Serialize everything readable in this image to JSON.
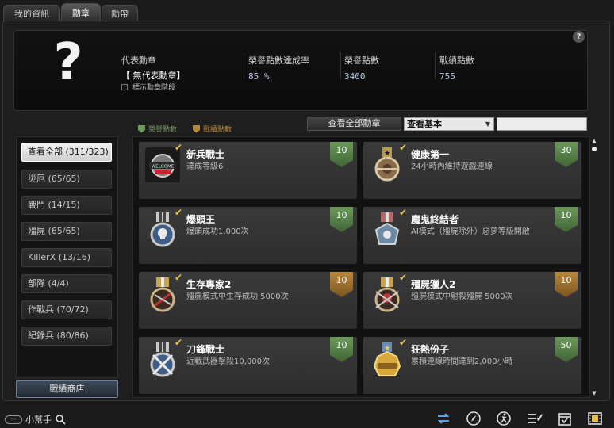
{
  "tabs": [
    {
      "label": "我的資訊"
    },
    {
      "label": "勳章"
    },
    {
      "label": "勳帶"
    }
  ],
  "header": {
    "placeholder_symbol": "?",
    "help_symbol": "?",
    "representative": {
      "label": "代表勳章",
      "value": "【 無代表勳章】"
    },
    "honor_rate": {
      "label": "榮譽點數達成率",
      "value": "85 %"
    },
    "honor_points": {
      "label": "榮譽點數",
      "value": "3400"
    },
    "battle_points": {
      "label": "戰績點數",
      "value": "755"
    },
    "show_stage_label": "標示勳章階段"
  },
  "legend": {
    "honor": "榮譽點數",
    "battle": "戰績點數",
    "honor_color": "#7c9a6c",
    "battle_color": "#b8893c"
  },
  "toolbar": {
    "view_all_label": "查看全部勳章",
    "filter_value": "查看基本",
    "search_value": ""
  },
  "sidebar": {
    "items": [
      {
        "label": "查看全部 (311/323)",
        "active": true
      },
      {
        "label": "災厄 (65/65)"
      },
      {
        "label": "戰鬥 (14/15)"
      },
      {
        "label": "殭屍 (65/65)"
      },
      {
        "label": "KillerX (13/16)"
      },
      {
        "label": "部隊 (4/4)"
      },
      {
        "label": "作戰兵 (70/72)"
      },
      {
        "label": "紀錄兵 (80/86)"
      }
    ],
    "shop_label": "戰績商店"
  },
  "medals": [
    {
      "name": "新兵戰士",
      "desc": "達成等級6",
      "points": "10",
      "type": "green",
      "icon": "welcome-medal-icon",
      "medal_text": "WELCOME"
    },
    {
      "name": "健康第一",
      "desc": "24小時內維持遊戲連線",
      "points": "30",
      "type": "green",
      "icon": "health-medal-icon"
    },
    {
      "name": "爆頭王",
      "desc": "爆頭成功1,000次",
      "points": "10",
      "type": "green",
      "icon": "skull-medal-icon"
    },
    {
      "name": "魔鬼終結者",
      "desc": "AI模式（殭屍除外）惡夢等級開啟",
      "points": "10",
      "type": "green",
      "icon": "terminator-medal-icon"
    },
    {
      "name": "生存專家2",
      "desc": "殭屍模式中生存成功 5000次",
      "points": "10",
      "type": "gold",
      "icon": "survivor-medal-icon"
    },
    {
      "name": "殭屍獵人2",
      "desc": "殭屍模式中射殺殭屍 5000次",
      "points": "10",
      "type": "gold",
      "icon": "zombie-hunter-medal-icon"
    },
    {
      "name": "刀鋒戰士",
      "desc": "近戰武器擊殺10,000次",
      "points": "10",
      "type": "green",
      "icon": "blade-medal-icon"
    },
    {
      "name": "狂熱份子",
      "desc": "累積連線時間達到2,000小時",
      "points": "50",
      "type": "green",
      "icon": "fanatic-medal-icon"
    }
  ],
  "footer": {
    "helper_label": "小幫手",
    "icons": [
      "swap-icon",
      "compass-icon",
      "runner-icon",
      "checklist-icon",
      "calendar-check-icon",
      "film-icon"
    ]
  }
}
